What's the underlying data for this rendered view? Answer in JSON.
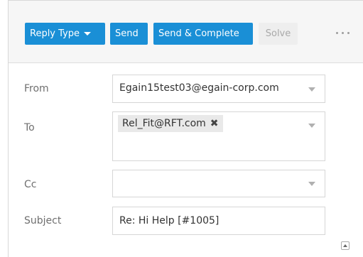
{
  "toolbar": {
    "reply_type_label": "Reply Type",
    "send_label": "Send",
    "send_complete_label": "Send & Complete",
    "solve_label": "Solve",
    "more_icon": "more-horizontal-icon"
  },
  "form": {
    "from": {
      "label": "From",
      "value": "Egain15test03@egain-corp.com"
    },
    "to": {
      "label": "To",
      "recipients": [
        "Rel_Fit@RFT.com"
      ]
    },
    "cc": {
      "label": "Cc",
      "value": ""
    },
    "subject": {
      "label": "Subject",
      "value": "Re: Hi Help [#1005]"
    }
  },
  "colors": {
    "primary_button": "#1a8fd6",
    "disabled_button": "#eeeeee",
    "toolbar_background": "#f6f6f6"
  }
}
